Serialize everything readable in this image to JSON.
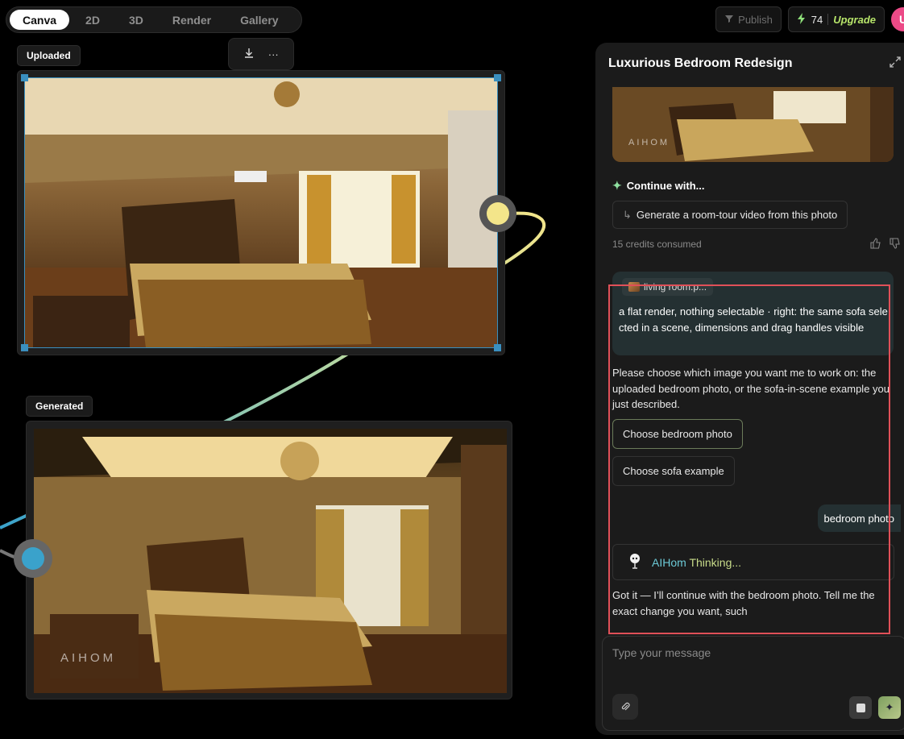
{
  "tabs": [
    {
      "label": "Canva"
    },
    {
      "label": "2D"
    },
    {
      "label": "3D"
    },
    {
      "label": "Render"
    },
    {
      "label": "Gallery"
    }
  ],
  "topbar": {
    "publish_label": "Publish",
    "credit_count": "74",
    "upgrade_label": "Upgrade",
    "avatar_initial": "U"
  },
  "canvas": {
    "uploaded_label": "Uploaded",
    "generated_label": "Generated",
    "toolbar_more": "···",
    "watermark": "AIHOM"
  },
  "panel": {
    "title": "Luxurious Bedroom Redesign",
    "thumb_watermark": "AIHOM",
    "continue_label": "Continue with...",
    "suggestion": "Generate a room-tour video from this photo",
    "credits_consumed": "15 credits consumed",
    "attachment_name": "living room.p...",
    "user_message": "a flat render, nothing selectable · right: the same sofa selected in a scene, dimensions and drag handles visible",
    "bot_message": "Please choose which image you want me to work on: the uploaded bedroom photo, or the sofa-in-scene example you just described.",
    "choice_1": "Choose bedroom photo",
    "choice_2": "Choose sofa example",
    "user_short": "bedroom photo",
    "thinking_brand": "AIHom",
    "thinking_word": "Thinking...",
    "bot_final": "Got it — I’ll continue with the bedroom photo. Tell me the exact change you want, such",
    "input_placeholder": "Type your message"
  },
  "colors": {
    "accent_green": "#b7e56a",
    "selection_blue": "#3a8fbf",
    "port_yellow": "#f3e58a",
    "port_blue": "#3aa2cb",
    "highlight_red": "#e05058"
  }
}
